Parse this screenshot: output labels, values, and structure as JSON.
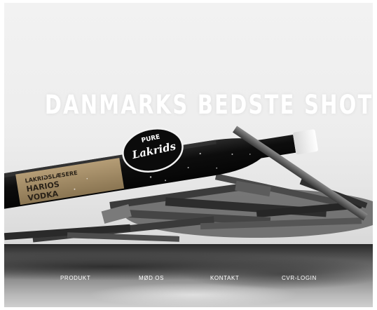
{
  "hero": {
    "headline": "DANMARKS BEDSTE SHOT",
    "bottle": {
      "badge_brand": "Lakrids",
      "badge_top": "PURE",
      "label_lines": [
        "LAKRIDSLÆSERE",
        "HARIOS",
        "VODKA"
      ]
    }
  },
  "nav": {
    "items": [
      {
        "label": "PRODUKT"
      },
      {
        "label": "MØD OS"
      },
      {
        "label": "KONTAKT"
      },
      {
        "label": "CVR-LOGIN"
      }
    ]
  },
  "colors": {
    "headline": "#ffffff",
    "nav_text": "#ffffff",
    "bottle_glass": "#111111",
    "label_gold": "#a08a65"
  }
}
